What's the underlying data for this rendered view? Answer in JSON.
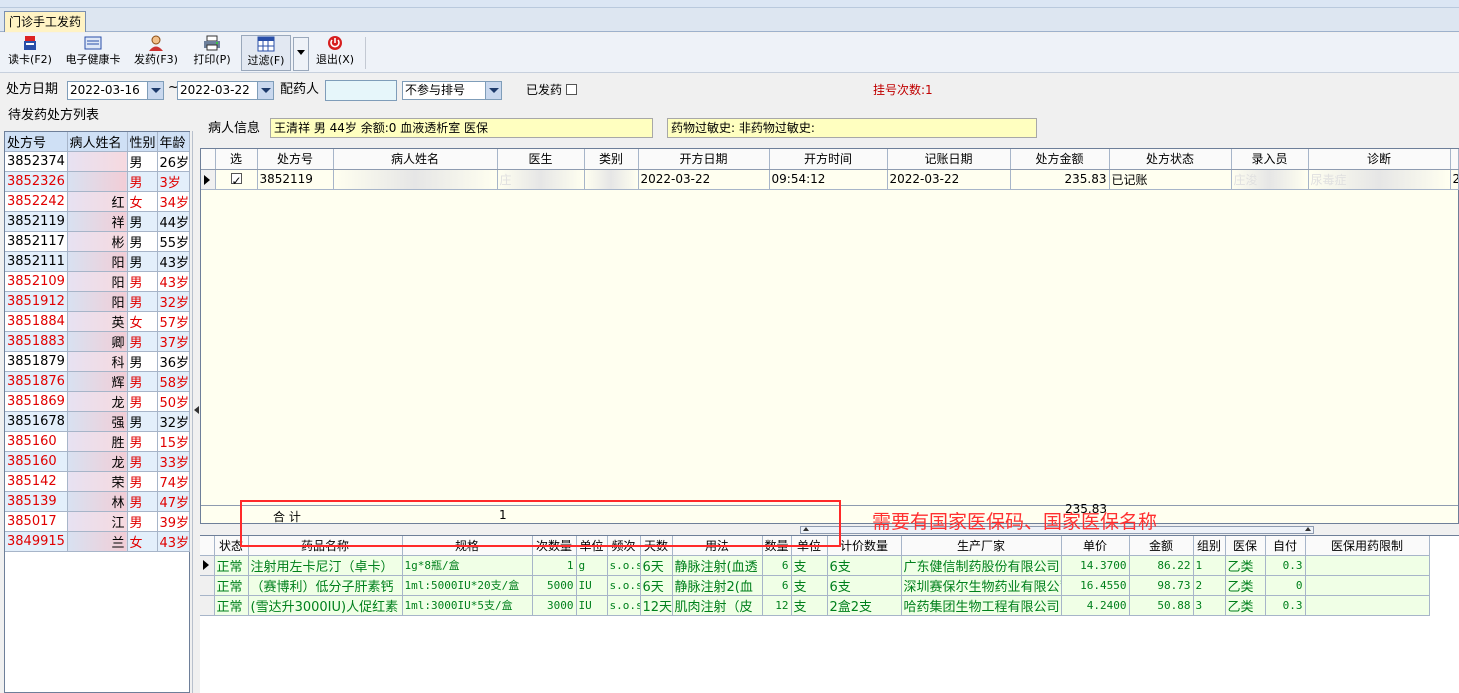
{
  "tab": {
    "label": "门诊手工发药"
  },
  "toolbar": {
    "read_card": "读卡(F2)",
    "health_card": "电子健康卡",
    "dispense": "发药(F3)",
    "print": "打印(P)",
    "filter": "过滤(F)",
    "exit": "退出(X)"
  },
  "filters": {
    "date_label": "处方日期",
    "date_from": "2022-03-16",
    "tilde": "~",
    "date_to": "2022-03-22",
    "dispenser_label": "配药人",
    "dispenser_value": "",
    "sort_option": "不参与排号",
    "dispensed_label": "已发药",
    "registration": "挂号次数:1"
  },
  "left_panel": {
    "title": "待发药处方列表",
    "columns": [
      "处方号",
      "病人姓名",
      "性别",
      "年龄"
    ],
    "rows": [
      {
        "id": "3852374",
        "name": "",
        "sex": "男",
        "age": "26岁",
        "red": false
      },
      {
        "id": "3852326",
        "name": "",
        "sex": "男",
        "age": "3岁",
        "red": true
      },
      {
        "id": "3852242",
        "name": "红",
        "sex": "女",
        "age": "34岁",
        "red": true
      },
      {
        "id": "3852119",
        "name": "祥",
        "sex": "男",
        "age": "44岁",
        "red": false
      },
      {
        "id": "3852117",
        "name": "彬",
        "sex": "男",
        "age": "55岁",
        "red": false
      },
      {
        "id": "3852111",
        "name": "阳",
        "sex": "男",
        "age": "43岁",
        "red": false
      },
      {
        "id": "3852109",
        "name": "阳",
        "sex": "男",
        "age": "43岁",
        "red": true
      },
      {
        "id": "3851912",
        "name": "阳",
        "sex": "男",
        "age": "32岁",
        "red": true
      },
      {
        "id": "3851884",
        "name": "英",
        "sex": "女",
        "age": "57岁",
        "red": true
      },
      {
        "id": "3851883",
        "name": "卿",
        "sex": "男",
        "age": "37岁",
        "red": true
      },
      {
        "id": "3851879",
        "name": "科",
        "sex": "男",
        "age": "36岁",
        "red": false
      },
      {
        "id": "3851876",
        "name": "辉",
        "sex": "男",
        "age": "58岁",
        "red": true
      },
      {
        "id": "3851869",
        "name": "龙",
        "sex": "男",
        "age": "50岁",
        "red": true
      },
      {
        "id": "3851678",
        "name": "强",
        "sex": "男",
        "age": "32岁",
        "red": false
      },
      {
        "id": "385160",
        "name": "胜",
        "sex": "男",
        "age": "15岁",
        "red": true
      },
      {
        "id": "385160",
        "name": "龙",
        "sex": "男",
        "age": "33岁",
        "red": true
      },
      {
        "id": "385142",
        "name": "荣",
        "sex": "男",
        "age": "74岁",
        "red": true
      },
      {
        "id": "385139",
        "name": "林",
        "sex": "男",
        "age": "47岁",
        "red": true
      },
      {
        "id": "385017",
        "name": "江",
        "sex": "男",
        "age": "39岁",
        "red": true
      },
      {
        "id": "3849915",
        "name": "兰",
        "sex": "女",
        "age": "43岁",
        "red": true
      }
    ]
  },
  "patient": {
    "label": "病人信息",
    "info": "王清祥  男 44岁 余额:0 血液透析室 医保",
    "allergy": "药物过敏史:      非药物过敏史:"
  },
  "prescriptions": {
    "columns": [
      "选",
      "处方号",
      "病人姓名",
      "医生",
      "类别",
      "开方日期",
      "开方时间",
      "记账日期",
      "处方金额",
      "处方状态",
      "录入员",
      "诊断"
    ],
    "rows": [
      {
        "id": "3852119",
        "name": "",
        "doctor": "庄",
        "category": "",
        "date": "2022-03-22",
        "time": "09:54:12",
        "bill_date": "2022-03-22",
        "amount": "235.83",
        "status": "已记账",
        "operator": "庄浚",
        "diagnosis": "尿毒症",
        "extra": "2"
      }
    ],
    "total_label": "合  计",
    "total_count": "1",
    "total_amount": "235.83"
  },
  "drugs": {
    "columns": [
      "状态",
      "药品名称",
      "规格",
      "次数量",
      "单位",
      "频次",
      "天数",
      "用法",
      "数量",
      "单位",
      "计价数量",
      "生产厂家",
      "单价",
      "金额",
      "组别",
      "医保",
      "自付",
      "医保用药限制"
    ],
    "rows": [
      {
        "status": "正常",
        "name": "注射用左卡尼汀（卓卡）",
        "spec": "1g*8瓶/盒",
        "dose": "1",
        "unit": "g",
        "freq": "s.o.s",
        "days": "6天",
        "usage": "静脉注射(血透",
        "qty": "6",
        "qunit": "支",
        "price_qty": "6支",
        "maker": "广东健信制药股份有限公司",
        "price": "14.3700",
        "amount": "86.22",
        "group": "1",
        "insurance": "乙类",
        "selfpay": "0.3",
        "limit": ""
      },
      {
        "status": "正常",
        "name": "（赛博利）低分子肝素钙",
        "spec": "1ml:5000IU*20支/盒",
        "dose": "5000",
        "unit": "IU",
        "freq": "s.o.s",
        "days": "6天",
        "usage": "静脉注射2(血",
        "qty": "6",
        "qunit": "支",
        "price_qty": "6支",
        "maker": "深圳赛保尔生物药业有限公司",
        "price": "16.4550",
        "amount": "98.73",
        "group": "2",
        "insurance": "乙类",
        "selfpay": "0",
        "limit": ""
      },
      {
        "status": "正常",
        "name": "(雪达升3000IU)人促红素",
        "spec": "1ml:3000IU*5支/盒",
        "dose": "3000",
        "unit": "IU",
        "freq": "s.o.s",
        "days": "12天",
        "usage": "肌肉注射（皮",
        "qty": "12",
        "qunit": "支",
        "price_qty": "2盒2支",
        "maker": "哈药集团生物工程有限公司",
        "price": "4.2400",
        "amount": "50.88",
        "group": "3",
        "insurance": "乙类",
        "selfpay": "0.3",
        "limit": ""
      }
    ]
  },
  "annotation": "需要有国家医保码、国家医保名称",
  "colors": {
    "accent_red": "#ff2a2a",
    "drug_green": "#00801c",
    "row_red": "#e00000"
  }
}
